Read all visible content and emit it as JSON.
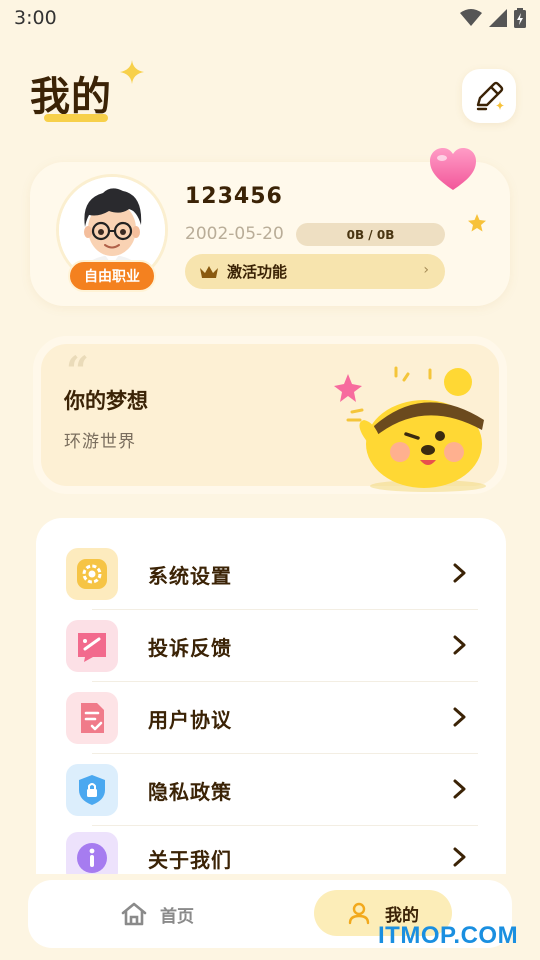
{
  "status_bar": {
    "time": "3:00"
  },
  "header": {
    "title": "我的"
  },
  "profile": {
    "username": "123456",
    "birthday": "2002-05-20",
    "storage": "0B / 0B",
    "role": "自由职业",
    "activate_label": "激活功能",
    "activate_chevron": "›"
  },
  "dream": {
    "quote": "“",
    "title": "你的梦想",
    "text": "环游世界"
  },
  "menu": {
    "items": [
      {
        "label": "系统设置",
        "icon": "gear-icon",
        "color": "#F6C445"
      },
      {
        "label": "投诉反馈",
        "icon": "feedback-icon",
        "color": "#F26A8D"
      },
      {
        "label": "用户协议",
        "icon": "document-icon",
        "color": "#F07B8A"
      },
      {
        "label": "隐私政策",
        "icon": "shield-lock-icon",
        "color": "#4AA8F0"
      },
      {
        "label": "关于我们",
        "icon": "info-icon",
        "color": "#A67CF0"
      }
    ]
  },
  "bottom_nav": {
    "home_label": "首页",
    "mine_label": "我的"
  },
  "watermark": "ITMOP.COM"
}
